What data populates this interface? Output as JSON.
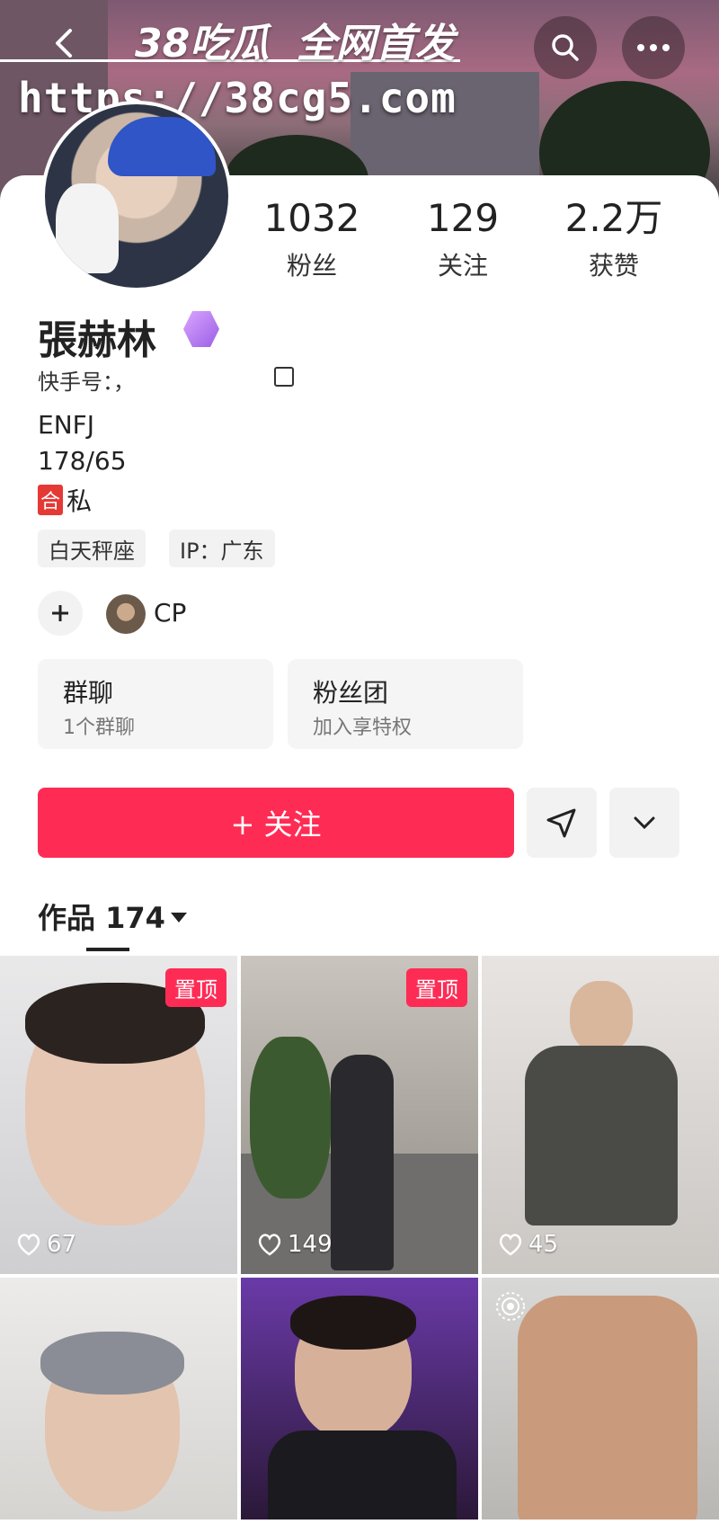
{
  "watermark": {
    "brand": "38吃瓜",
    "slogan": "全网首发",
    "url": "https://38cg5.com"
  },
  "profile": {
    "name": "張赫林",
    "kuaishou_id": "快手号：，",
    "bio": [
      "ENFJ",
      "178/65"
    ],
    "he_badge": "合",
    "bio_private": "私",
    "tags": [
      "白天秤座",
      "IP：广东"
    ],
    "cp_label": "CP"
  },
  "stats": [
    {
      "value": "1032",
      "label": "粉丝"
    },
    {
      "value": "129",
      "label": "关注"
    },
    {
      "value": "2.2万",
      "label": "获赞"
    }
  ],
  "boxes": [
    {
      "title": "群聊",
      "subtitle": "1个群聊"
    },
    {
      "title": "粉丝团",
      "subtitle": "加入享特权"
    }
  ],
  "follow_label": "+ 关注",
  "works_label": "作品 174",
  "pinned_label": "置顶",
  "videos": [
    {
      "likes": "67",
      "pinned": true
    },
    {
      "likes": "149",
      "pinned": true
    },
    {
      "likes": "45",
      "pinned": false
    },
    {
      "likes": "",
      "pinned": false
    },
    {
      "likes": "",
      "pinned": false
    },
    {
      "likes": "",
      "pinned": false
    }
  ],
  "colors": {
    "accent": "#fe2c55",
    "badge": "#9b5de5"
  }
}
